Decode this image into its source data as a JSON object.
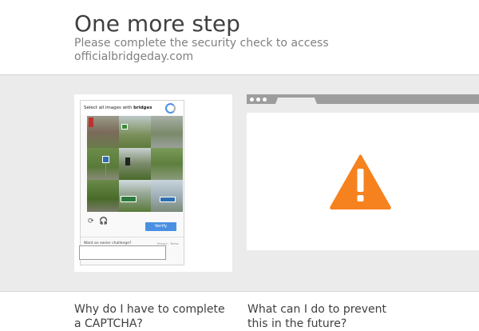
{
  "header": {
    "title": "One more step",
    "subtitle": "Please complete the security check to access officialbridgeday.com"
  },
  "captcha": {
    "instruction_prefix": "Select all images with",
    "instruction_target": "bridges",
    "reload_icon": "reload-icon",
    "audio_icon": "headphones-icon",
    "verify_label": "Verify",
    "easier_link": "Want an easier challenge?",
    "privacy_terms": "Privacy - Terms",
    "tiles": [
      "tile-1",
      "tile-2",
      "tile-3",
      "tile-4",
      "tile-5",
      "tile-6",
      "tile-7",
      "tile-8",
      "tile-9"
    ],
    "accent_color": "#4a90e2"
  },
  "illustration": {
    "warning_icon": "warning-icon",
    "warning_color": "#f6821f"
  },
  "faq": {
    "q1": "Why do I have to complete a CAPTCHA?",
    "q2": "What can I do to prevent this in the future?"
  }
}
